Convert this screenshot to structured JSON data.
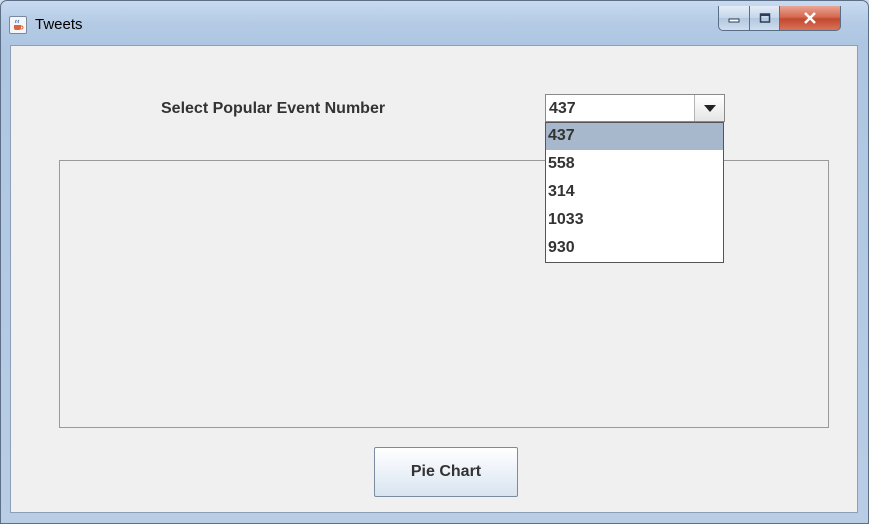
{
  "window": {
    "title": "Tweets"
  },
  "label_text": "Select Popular Event Number",
  "combo": {
    "selected": "437",
    "options": [
      "437",
      "558",
      "314",
      "1033",
      "930"
    ],
    "highlighted_index": 0
  },
  "buttons": {
    "pie_chart": "Pie Chart"
  },
  "icons": {
    "app": "java-cup-icon",
    "minimize": "minimize-icon",
    "maximize": "maximize-icon",
    "close": "close-icon",
    "dropdown": "chevron-down-icon"
  },
  "colors": {
    "selection": "#a8b8cc",
    "close_button": "#c24a2f"
  }
}
